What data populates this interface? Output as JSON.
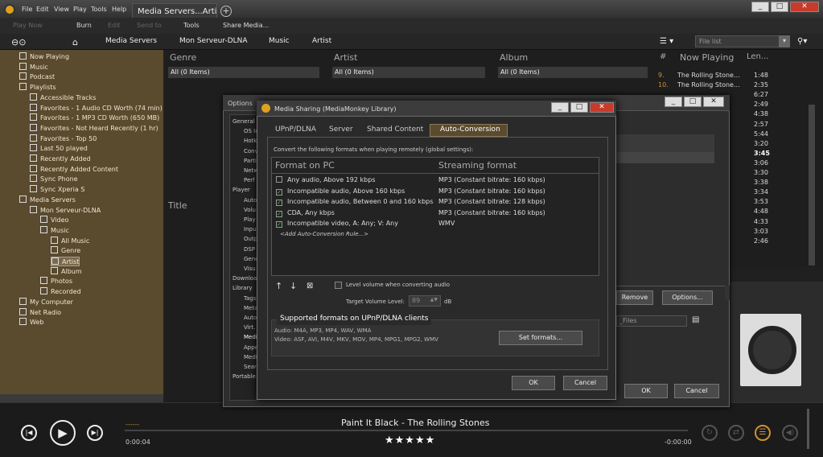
{
  "menu": [
    "File",
    "Edit",
    "View",
    "Play",
    "Tools",
    "Help"
  ],
  "tab_title": "Media Servers...Artist",
  "toolbar": {
    "play_now": "Play Now",
    "burn": "Burn",
    "edit": "Edit",
    "send_to": "Send to",
    "tools": "Tools",
    "share": "Share Media..."
  },
  "breadcrumb": [
    "Media Servers",
    "Mon Serveur-DLNA",
    "Music",
    "Artist"
  ],
  "file_list_placeholder": "File list",
  "tree": [
    {
      "label": "Now Playing",
      "indent": 0
    },
    {
      "label": "Music",
      "indent": 0
    },
    {
      "label": "Podcast",
      "indent": 0
    },
    {
      "label": "Playlists",
      "indent": 0
    },
    {
      "label": "Accessible Tracks",
      "indent": 1
    },
    {
      "label": "Favorites - 1 Audio CD Worth (74 min)",
      "indent": 1
    },
    {
      "label": "Favorites - 1 MP3 CD Worth (650 MB)",
      "indent": 1
    },
    {
      "label": "Favorites - Not Heard Recently (1 hr)",
      "indent": 1
    },
    {
      "label": "Favorites - Top 50",
      "indent": 1
    },
    {
      "label": "Last 50 played",
      "indent": 1
    },
    {
      "label": "Recently Added",
      "indent": 1
    },
    {
      "label": "Recently Added Content",
      "indent": 1
    },
    {
      "label": "Sync Phone",
      "indent": 1
    },
    {
      "label": "Sync Xperia S",
      "indent": 1
    },
    {
      "label": "Media Servers",
      "indent": 0
    },
    {
      "label": "Mon Serveur-DLNA",
      "indent": 1
    },
    {
      "label": "Video",
      "indent": 2
    },
    {
      "label": "Music",
      "indent": 2
    },
    {
      "label": "All Music",
      "indent": 3
    },
    {
      "label": "Genre",
      "indent": 3
    },
    {
      "label": "Artist",
      "indent": 3
    },
    {
      "label": "Album",
      "indent": 3
    },
    {
      "label": "Photos",
      "indent": 2
    },
    {
      "label": "Recorded",
      "indent": 2
    },
    {
      "label": "My Computer",
      "indent": 0
    },
    {
      "label": "Net Radio",
      "indent": 0
    },
    {
      "label": "Web",
      "indent": 0
    }
  ],
  "columns": {
    "genre": "Genre",
    "artist": "Artist",
    "album": "Album",
    "all_items": "All (0 Items)",
    "title": "Title"
  },
  "now_playing": {
    "hash": "#",
    "header": "Now Playing",
    "len": "Len...",
    "rows": [
      {
        "n": "9.",
        "title": "The Rolling Stone...",
        "len": "1:48"
      },
      {
        "n": "10.",
        "title": "The Rolling Stone...",
        "len": "2:35"
      },
      {
        "n": "",
        "title": "",
        "len": "6:27"
      },
      {
        "n": "",
        "title": "",
        "len": "2:49"
      },
      {
        "n": "",
        "title": "",
        "len": "4:38"
      },
      {
        "n": "",
        "title": "",
        "len": "2:57"
      },
      {
        "n": "",
        "title": "",
        "len": "5:44"
      },
      {
        "n": "",
        "title": "",
        "len": "3:20"
      },
      {
        "n": "",
        "title": "",
        "len": "3:45"
      },
      {
        "n": "",
        "title": "",
        "len": "3:06"
      },
      {
        "n": "",
        "title": "",
        "len": "3:30"
      },
      {
        "n": "",
        "title": "",
        "len": "3:38"
      },
      {
        "n": "",
        "title": "",
        "len": "3:34"
      },
      {
        "n": "",
        "title": "",
        "len": "3:53"
      },
      {
        "n": "",
        "title": "",
        "len": "4:48"
      },
      {
        "n": "",
        "title": "",
        "len": "4:33"
      },
      {
        "n": "",
        "title": "",
        "len": "3:03"
      },
      {
        "n": "",
        "title": "",
        "len": "2:46"
      }
    ]
  },
  "options_dialog": {
    "title": "Options",
    "ok": "OK",
    "cancel": "Cancel",
    "remove": "Remove",
    "options_btn": "Options...",
    "files_field": "_Files",
    "selected_tab": "ected",
    "categories": [
      "General",
      "OS In",
      "Hotk",
      "Conv",
      "Parti",
      "Netw",
      "Perf",
      "Player",
      "Auto",
      "Volu",
      "Play",
      "Inpu",
      "Outp",
      "DSP",
      "Gene",
      "Visu",
      "Download",
      "Library",
      "Tags",
      "Meta",
      "Auto",
      "Virt.",
      "Medi",
      "Appe",
      "Medi",
      "Sear",
      "Portable"
    ]
  },
  "sharing_dialog": {
    "title": "Media Sharing (MediaMonkey Library)",
    "tabs": [
      "UPnP/DLNA",
      "Server",
      "Shared Content",
      "Auto-Conversion"
    ],
    "intro": "Convert the following formats when playing remotely (global settings):",
    "col_format": "Format on PC",
    "col_stream": "Streaming format",
    "rules": [
      {
        "checked": false,
        "format": "Any audio, Above 192 kbps",
        "stream": "MP3 (Constant bitrate: 160 kbps)"
      },
      {
        "checked": true,
        "format": "Incompatible audio, Above 160 kbps",
        "stream": "MP3 (Constant bitrate: 160 kbps)"
      },
      {
        "checked": true,
        "format": "Incompatible audio, Between 0 and 160 kbps",
        "stream": "MP3 (Constant bitrate: 128 kbps)"
      },
      {
        "checked": true,
        "format": "CDA, Any kbps",
        "stream": "MP3 (Constant bitrate: 160 kbps)"
      },
      {
        "checked": true,
        "format": "Incompatible video, A: Any; V: Any",
        "stream": "WMV"
      }
    ],
    "add_rule": "<Add Auto-Conversion Rule...>",
    "level_volume": "Level volume when converting audio",
    "target_volume_label": "Target Volume Level:",
    "target_volume_value": "89",
    "db": "dB",
    "supported_title": "Supported formats on UPnP/DLNA clients",
    "audio_formats": "Audio: M4A, MP3, MP4, WAV, WMA",
    "video_formats": "Video: ASF, AVI, M4V, MKV, MOV, MP4, MPG1, MPG2, WMV",
    "set_formats": "Set formats...",
    "ok": "OK",
    "cancel": "Cancel"
  },
  "player": {
    "track": "Paint It Black - The Rolling Stones",
    "elapsed": "0:00:04",
    "remaining": "-0:00:00",
    "rating": "★★★★★",
    "seek": "------"
  },
  "colors": {
    "accent": "#d09030",
    "tree_bg": "#5a4a2e"
  }
}
